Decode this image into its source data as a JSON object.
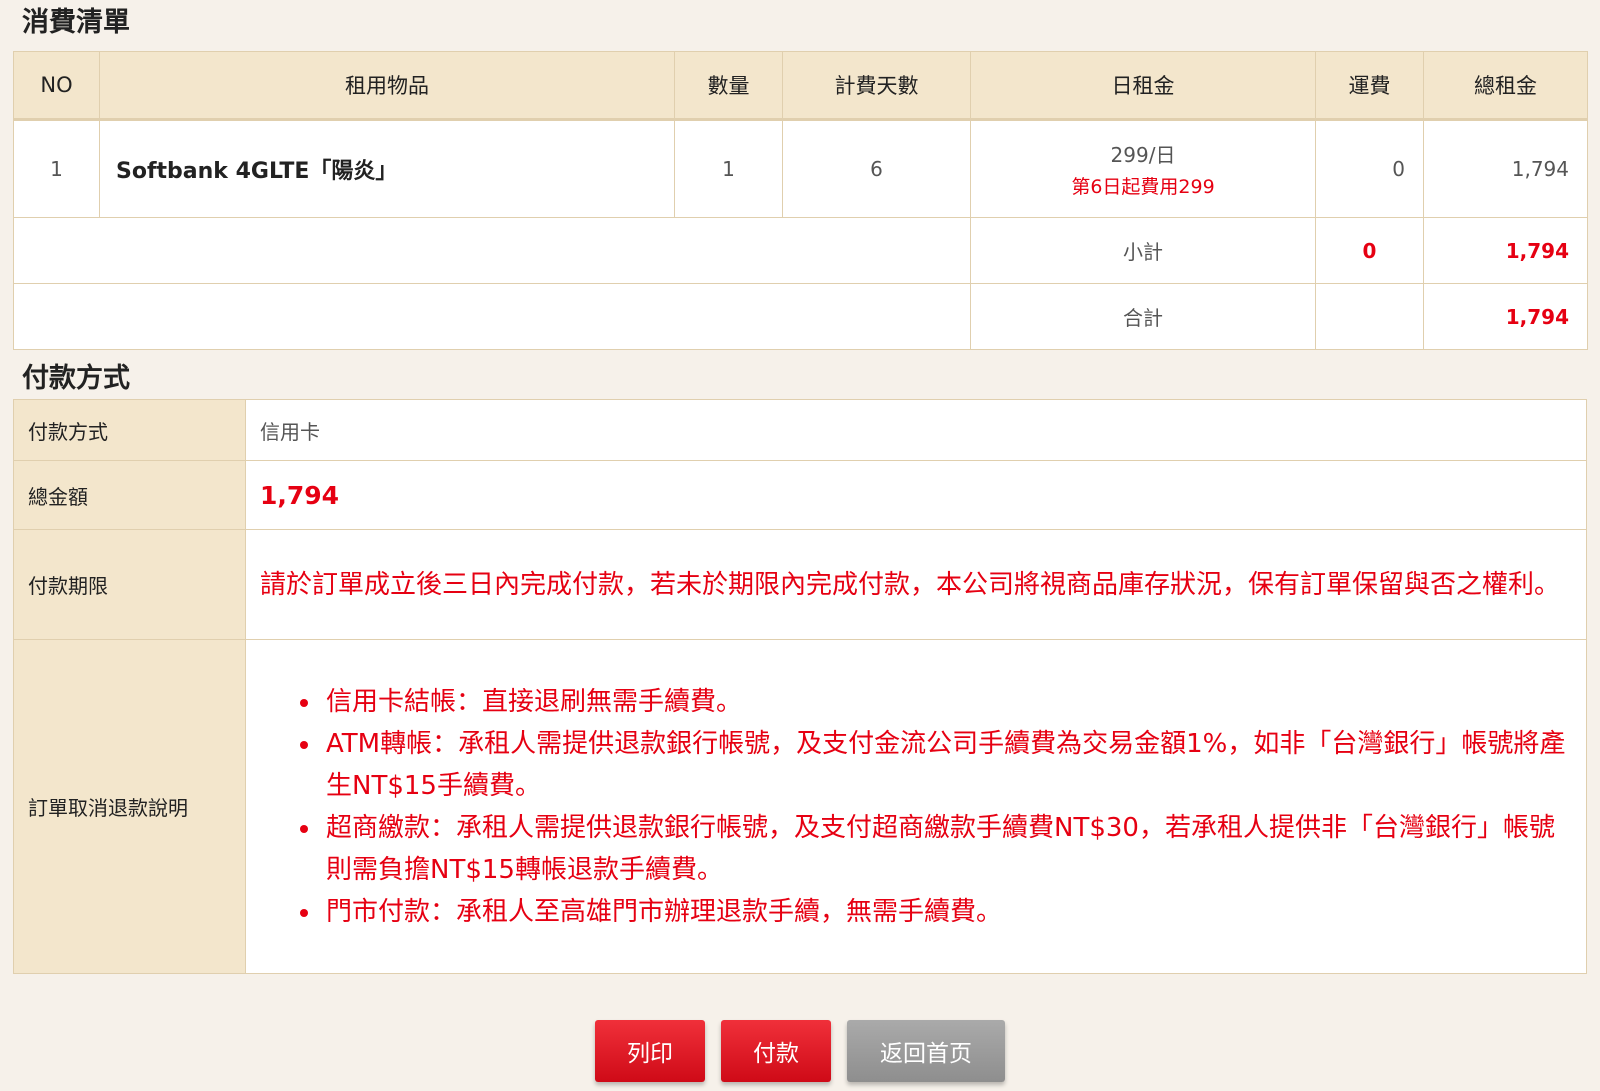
{
  "orders": {
    "title": "消費清單",
    "headers": [
      "NO",
      "租用物品",
      "數量",
      "計費天數",
      "日租金",
      "運費",
      "總租金"
    ],
    "items": [
      {
        "no": "1",
        "name": "Softbank 4GLTE「陽炎」",
        "qty": "1",
        "days": "6",
        "daily": "299/日",
        "daily_note": "第6日起費用299",
        "shipping": "0",
        "total": "1,794"
      }
    ],
    "subtotal": {
      "label": "小計",
      "shipping": "0",
      "total": "1,794"
    },
    "grand_total": {
      "label": "合計",
      "total": "1,794"
    }
  },
  "payment": {
    "title": "付款方式",
    "method_label": "付款方式",
    "method_value": "信用卡",
    "total_label": "總金額",
    "total_value": "1,794",
    "deadline_label": "付款期限",
    "deadline_text": "請於訂單成立後三日內完成付款，若未於期限內完成付款，本公司將視商品庫存狀況，保有訂單保留與否之權利。",
    "refund_label": "訂單取消退款說明",
    "refund_items": [
      "信用卡結帳：直接退刷無需手續費。",
      "ATM轉帳：承租人需提供退款銀行帳號，及支付金流公司手續費為交易金額1%，如非「台灣銀行」帳號將產生NT$15手續費。",
      "超商繳款：承租人需提供退款銀行帳號，及支付超商繳款手續費NT$30，若承租人提供非「台灣銀行」帳號則需負擔NT$15轉帳退款手續費。",
      "門市付款：承租人至高雄門市辦理退款手續，無需手續費。"
    ]
  },
  "buttons": {
    "print": "列印",
    "pay": "付款",
    "home": "返回首页"
  },
  "colors": {
    "accent_red": "#e60012",
    "header_bg": "#f3e6cc",
    "page_bg": "#f6f1ea",
    "border": "#e0cfae",
    "button_gray": "#9a9a9a"
  }
}
